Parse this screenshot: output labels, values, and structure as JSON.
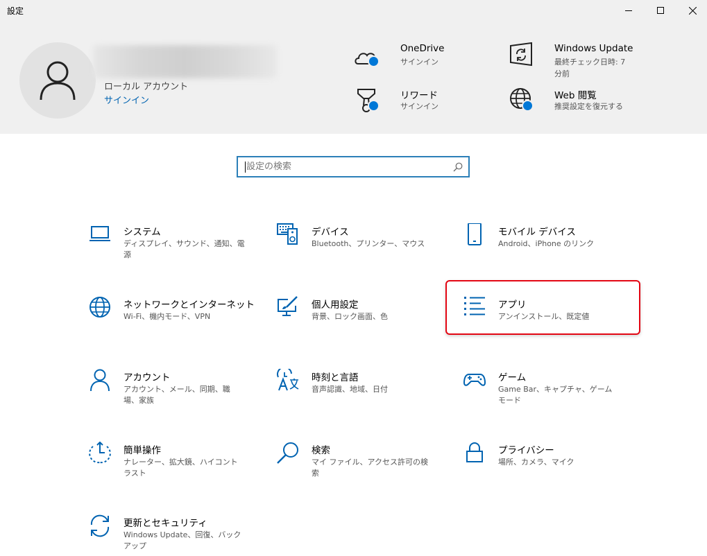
{
  "window": {
    "title": "設定",
    "controls": [
      "minimize-icon",
      "maximize-icon",
      "close-icon"
    ]
  },
  "header": {
    "account_type": "ローカル アカウント",
    "signin_label": "サインイン",
    "items": [
      {
        "title": "OneDrive",
        "sub": "サインイン",
        "icon": "onedrive-cloud-icon"
      },
      {
        "title": "Windows Update",
        "sub": "最終チェック日時: 7 分前",
        "icon": "windows-update-icon"
      },
      {
        "title": "リワード",
        "sub": "サインイン",
        "icon": "rewards-trophy-icon"
      },
      {
        "title": "Web 閲覧",
        "sub": "推奨設定を復元する",
        "icon": "globe-icon"
      }
    ]
  },
  "search": {
    "placeholder": "設定の検索"
  },
  "categories": [
    {
      "title": "システム",
      "desc": "ディスプレイ、サウンド、通知、電源",
      "icon": "laptop-icon"
    },
    {
      "title": "デバイス",
      "desc": "Bluetooth、プリンター、マウス",
      "icon": "keyboard-speaker-icon"
    },
    {
      "title": "モバイル デバイス",
      "desc": "Android、iPhone のリンク",
      "icon": "phone-icon"
    },
    {
      "title": "ネットワークとインターネット",
      "desc": "Wi-Fi、機内モード、VPN",
      "icon": "globe-icon"
    },
    {
      "title": "個人用設定",
      "desc": "背景、ロック画面、色",
      "icon": "paint-monitor-icon"
    },
    {
      "title": "アプリ",
      "desc": "アンインストール、既定値",
      "icon": "app-list-icon"
    },
    {
      "title": "アカウント",
      "desc": "アカウント、メール、同期、職場、家族",
      "icon": "person-icon"
    },
    {
      "title": "時刻と言語",
      "desc": "音声認識、地域、日付",
      "icon": "time-language-icon"
    },
    {
      "title": "ゲーム",
      "desc": "Game Bar、キャプチャ、ゲーム モード",
      "icon": "gamepad-icon"
    },
    {
      "title": "簡単操作",
      "desc": "ナレーター、拡大鏡、ハイコントラスト",
      "icon": "ease-of-access-icon"
    },
    {
      "title": "検索",
      "desc": "マイ ファイル、アクセス許可の検索",
      "icon": "magnifier-icon"
    },
    {
      "title": "プライバシー",
      "desc": "場所、カメラ、マイク",
      "icon": "lock-icon"
    },
    {
      "title": "更新とセキュリティ",
      "desc": "Windows Update、回復、バックアップ",
      "icon": "sync-arrows-icon"
    }
  ],
  "colors": {
    "accent": "#0063b1",
    "badge": "#0078d7",
    "header_bg": "#f0f0f0",
    "highlight": "#e30613"
  }
}
